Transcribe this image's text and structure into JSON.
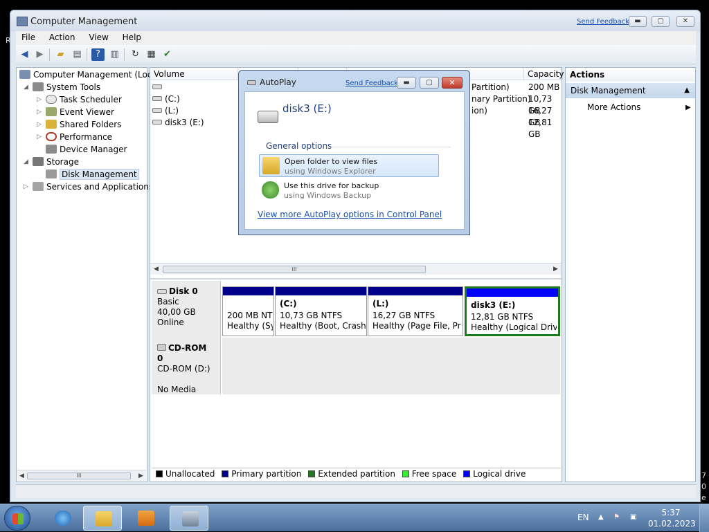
{
  "window": {
    "title": "Computer Management",
    "send_feedback": "Send Feedback",
    "min_glyph": "▬",
    "max_glyph": "▢",
    "close_glyph": "✕"
  },
  "menu": [
    "File",
    "Action",
    "View",
    "Help"
  ],
  "toolbar": [
    "back-icon",
    "forward-icon",
    "up-folder-icon",
    "show-hide-tree-icon",
    "help-icon",
    "show-hide-action-pane-icon",
    "refresh-icon",
    "properties-icon",
    "settings-icon"
  ],
  "tree": {
    "root": "Computer Management (Local",
    "system_tools": "System Tools",
    "task_scheduler": "Task Scheduler",
    "event_viewer": "Event Viewer",
    "shared_folders": "Shared Folders",
    "performance": "Performance",
    "device_manager": "Device Manager",
    "storage": "Storage",
    "disk_management": "Disk Management",
    "services_apps": "Services and Applications",
    "scroll_grip": "III"
  },
  "volume_list": {
    "col_volume": "Volume",
    "col_capacity": "Capacity",
    "rows": [
      {
        "volume": "",
        "type_partial": "Partition)",
        "capacity": "200 MB"
      },
      {
        "volume": "(C:)",
        "type_partial": "nary Partition)",
        "capacity": "10,73 GB"
      },
      {
        "volume": "(L:)",
        "type_partial": "ion)",
        "capacity": "16,27 GB"
      },
      {
        "volume": "disk3 (E:)",
        "type_partial": "",
        "capacity": "12,81 GB"
      }
    ],
    "scroll_grip": "III"
  },
  "disks": {
    "disk0": {
      "name": "Disk 0",
      "type": "Basic",
      "size": "40,00 GB",
      "status": "Online"
    },
    "cdrom0": {
      "name": "CD-ROM 0",
      "type": "CD-ROM (D:)",
      "status": "No Media"
    },
    "partitions": [
      {
        "name": "",
        "size": "200 MB NTI",
        "status": "Healthy (Sy"
      },
      {
        "name": "(C:)",
        "size": "10,73 GB NTFS",
        "status": "Healthy (Boot, Crash D"
      },
      {
        "name": "(L:)",
        "size": "16,27 GB NTFS",
        "status": "Healthy (Page File, Prim"
      },
      {
        "name": "disk3  (E:)",
        "size": "12,81 GB NTFS",
        "status": "Healthy (Logical Drive"
      }
    ]
  },
  "legend": [
    {
      "label": "Unallocated",
      "color": "#000000"
    },
    {
      "label": "Primary partition",
      "color": "#00008b"
    },
    {
      "label": "Extended partition",
      "color": "#1d7a1d"
    },
    {
      "label": "Free space",
      "color": "#33ee33"
    },
    {
      "label": "Logical drive",
      "color": "#0000ff"
    }
  ],
  "actions": {
    "header": "Actions",
    "section": "Disk Management",
    "section_arrow": "▲",
    "more": "More Actions",
    "more_arrow": "▶"
  },
  "autoplay": {
    "title": "AutoPlay",
    "send_feedback": "Send Feedback",
    "disk_name": "disk3 (E:)",
    "section": "General options",
    "option1_title": "Open folder to view files",
    "option1_sub": "using Windows Explorer",
    "option2_title": "Use this drive for backup",
    "option2_sub": "using Windows Backup",
    "link": "View more AutoPlay options in Control Panel"
  },
  "taskbar": {
    "language": "EN",
    "time": "5:37",
    "date": "01.02.2023"
  },
  "desktop_fragments": {
    "left_char": "R",
    "right_chars": "7\n0\ne"
  },
  "accent_colors": {
    "primary_partition": "#00008b",
    "logical_drive": "#0000ff",
    "selected_border": "#1d7a1d",
    "link": "#1a4fa8"
  }
}
